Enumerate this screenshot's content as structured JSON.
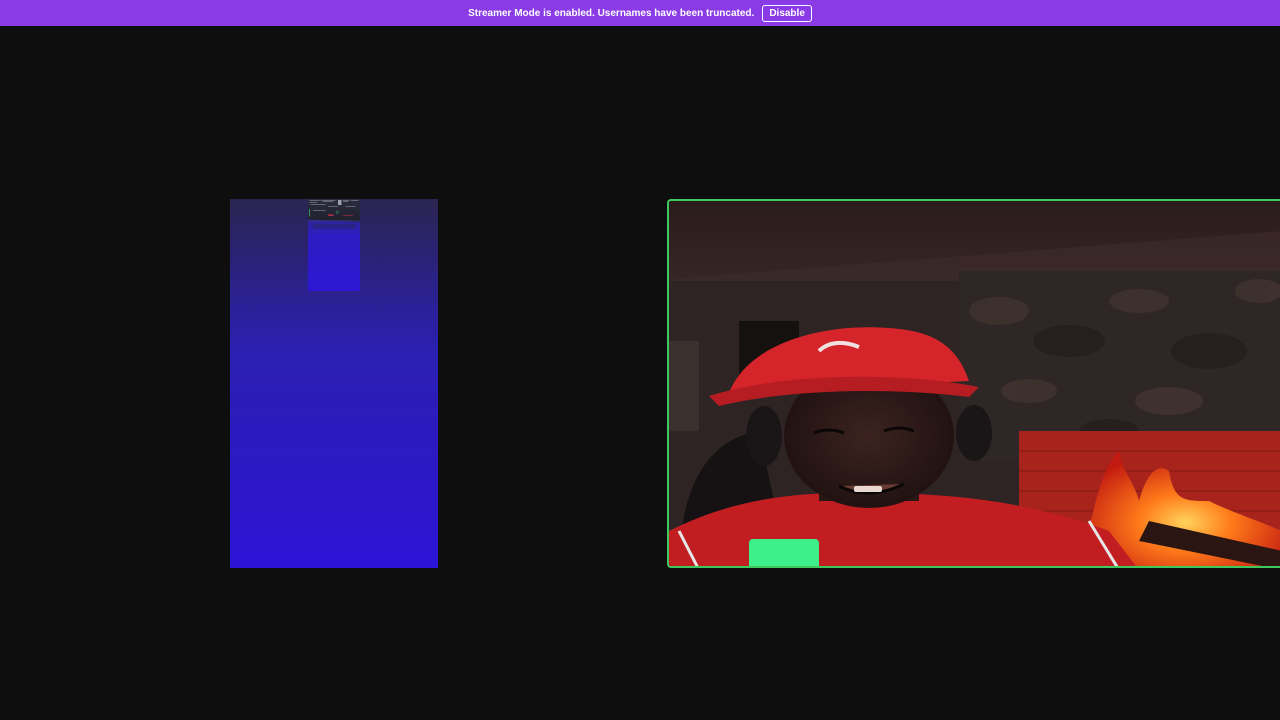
{
  "banner": {
    "message": "Streamer Mode is enabled. Usernames have been truncated.",
    "disable_label": "Disable"
  },
  "colors": {
    "banner_bg": "#8a3be6",
    "stage_bg": "#0e0e0f",
    "speaking_ring": "#3ec95e"
  },
  "tiles": [
    {
      "id": "left",
      "state": "video",
      "speaking": false
    },
    {
      "id": "right",
      "state": "video",
      "speaking": true
    }
  ]
}
